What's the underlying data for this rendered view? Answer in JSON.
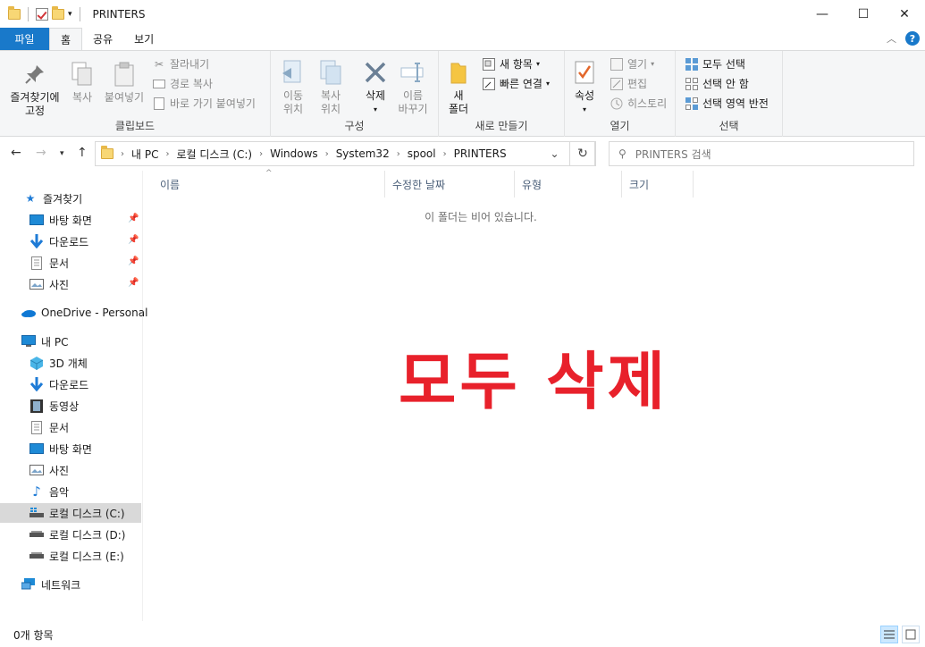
{
  "window": {
    "title": "PRINTERS",
    "minimize": "—",
    "maximize": "☐",
    "close": "✕"
  },
  "ribbon_tabs": [
    {
      "label": "파일"
    },
    {
      "label": "홈"
    },
    {
      "label": "공유"
    },
    {
      "label": "보기"
    }
  ],
  "ribbon": {
    "clipboard": {
      "pin": "즐겨찾기에\n고정",
      "copy": "복사",
      "paste": "붙여넣기",
      "cut": "잘라내기",
      "copy_path": "경로 복사",
      "paste_shortcut": "바로 가기 붙여넣기",
      "label": "클립보드"
    },
    "organize": {
      "move_to": "이동\n위치",
      "copy_to": "복사\n위치",
      "delete": "삭제",
      "rename": "이름\n바꾸기",
      "label": "구성"
    },
    "new": {
      "new_folder": "새\n폴더",
      "new_item": "새 항목",
      "easy_access": "빠른 연결",
      "label": "새로 만들기"
    },
    "open": {
      "properties": "속성",
      "open": "열기",
      "edit": "편집",
      "history": "히스토리",
      "label": "열기"
    },
    "select": {
      "select_all": "모두 선택",
      "select_none": "선택 안 함",
      "invert": "선택 영역 반전",
      "label": "선택"
    }
  },
  "address": {
    "crumbs": [
      "내 PC",
      "로컬 디스크 (C:)",
      "Windows",
      "System32",
      "spool",
      "PRINTERS"
    ],
    "search_placeholder": "PRINTERS 검색"
  },
  "nav": {
    "quick_access": "즐겨찾기",
    "qa_items": [
      "바탕 화면",
      "다운로드",
      "문서",
      "사진"
    ],
    "onedrive": "OneDrive - Personal",
    "this_pc": "내 PC",
    "pc_items": [
      "3D 개체",
      "다운로드",
      "동영상",
      "문서",
      "바탕 화면",
      "사진",
      "음악",
      "로컬 디스크 (C:)",
      "로컬 디스크 (D:)",
      "로컬 디스크 (E:)"
    ],
    "network": "네트워크"
  },
  "columns": [
    "이름",
    "수정한 날짜",
    "유형",
    "크기"
  ],
  "empty_message": "이 폴더는 비어 있습니다.",
  "overlay_text": "모두 삭제",
  "status": {
    "item_count": "0개 항목"
  },
  "colors": {
    "file_tab": "#1979ca",
    "overlay": "#e8212b",
    "selected_nav": "#d9d9d9"
  }
}
